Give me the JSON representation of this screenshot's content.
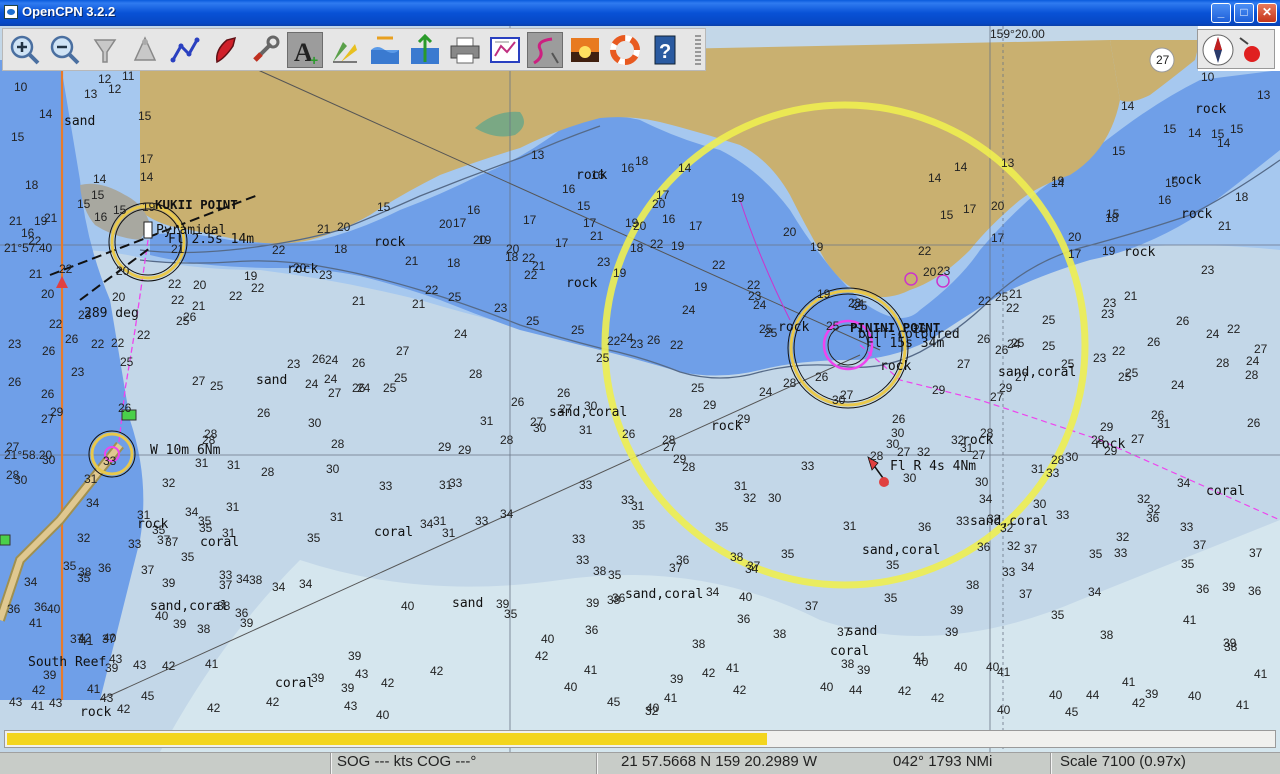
{
  "window": {
    "title": "OpenCPN 3.2.2",
    "minimize_label": "_",
    "maximize_label": "□",
    "close_label": "✕"
  },
  "toolbar": {
    "tools": [
      {
        "name": "zoom-in-tool",
        "icon": "magnifier-plus-icon"
      },
      {
        "name": "zoom-out-tool",
        "icon": "magnifier-minus-icon"
      },
      {
        "name": "scale-in-tool",
        "icon": "funnel-icon"
      },
      {
        "name": "scale-out-tool",
        "icon": "cone-icon"
      },
      {
        "name": "route-tool",
        "icon": "route-icon"
      },
      {
        "name": "auto-follow-tool",
        "icon": "ship-icon"
      },
      {
        "name": "settings-tool",
        "icon": "wrench-icon"
      },
      {
        "name": "text-toggle-tool",
        "icon": "text-a-icon",
        "active": true
      },
      {
        "name": "current-tool",
        "icon": "arrows-icon"
      },
      {
        "name": "tide-tool",
        "icon": "tide-icon"
      },
      {
        "name": "chart-quilt-tool",
        "icon": "chart-quilt-icon"
      },
      {
        "name": "print-tool",
        "icon": "printer-icon"
      },
      {
        "name": "route-manager-tool",
        "icon": "route-manager-icon"
      },
      {
        "name": "track-tool",
        "icon": "track-icon",
        "active": true
      },
      {
        "name": "color-scheme-tool",
        "icon": "sunset-icon"
      },
      {
        "name": "mob-tool",
        "icon": "lifebuoy-icon"
      },
      {
        "name": "help-tool",
        "icon": "help-icon"
      }
    ]
  },
  "compass": {
    "icon": "compass-icon",
    "gps_icon": "gps-status-icon"
  },
  "chart": {
    "colors": {
      "land": "#c9b070",
      "shallow": "#6f9fe8",
      "mid": "#a6c8ef",
      "deep": "#c3d7e8",
      "deepest": "#d5e6ee",
      "range_ring": "#eeee50",
      "route": "#ee44ee",
      "ownship_track": "#e87b2a"
    },
    "grid_labels": {
      "top": "159°20.00",
      "left1": "21°57.40",
      "left2": "21°58.20"
    },
    "place_labels": {
      "kukii": "KUKII POINT",
      "pinini": "PININI POINT",
      "south_reef": "South Reef",
      "buff_col": "buff-coloured",
      "pyramidal": "Pyramidal"
    },
    "light_labels": {
      "kukii": "Fl 2.5s 14m",
      "pinini": "Fl 15s 34m",
      "buoy": "Fl R 4s 4Nm",
      "west": "W 10m 6Nm"
    },
    "bearing_label": "289 deg",
    "zoom_badge": "27",
    "bottom_depth": "32",
    "seabed_labels": {
      "rock": "rock",
      "sand": "sand",
      "coral": "coral",
      "sand_coral": "sand,coral"
    }
  },
  "progress": {
    "fraction": 0.6
  },
  "status": {
    "sog": "SOG --- kts  COG ---°",
    "position": "21 57.5668 N   159 20.2989 W",
    "bearing_distance": "042°  1793 NMi",
    "scale": "Scale 7100 (0.97x)"
  }
}
